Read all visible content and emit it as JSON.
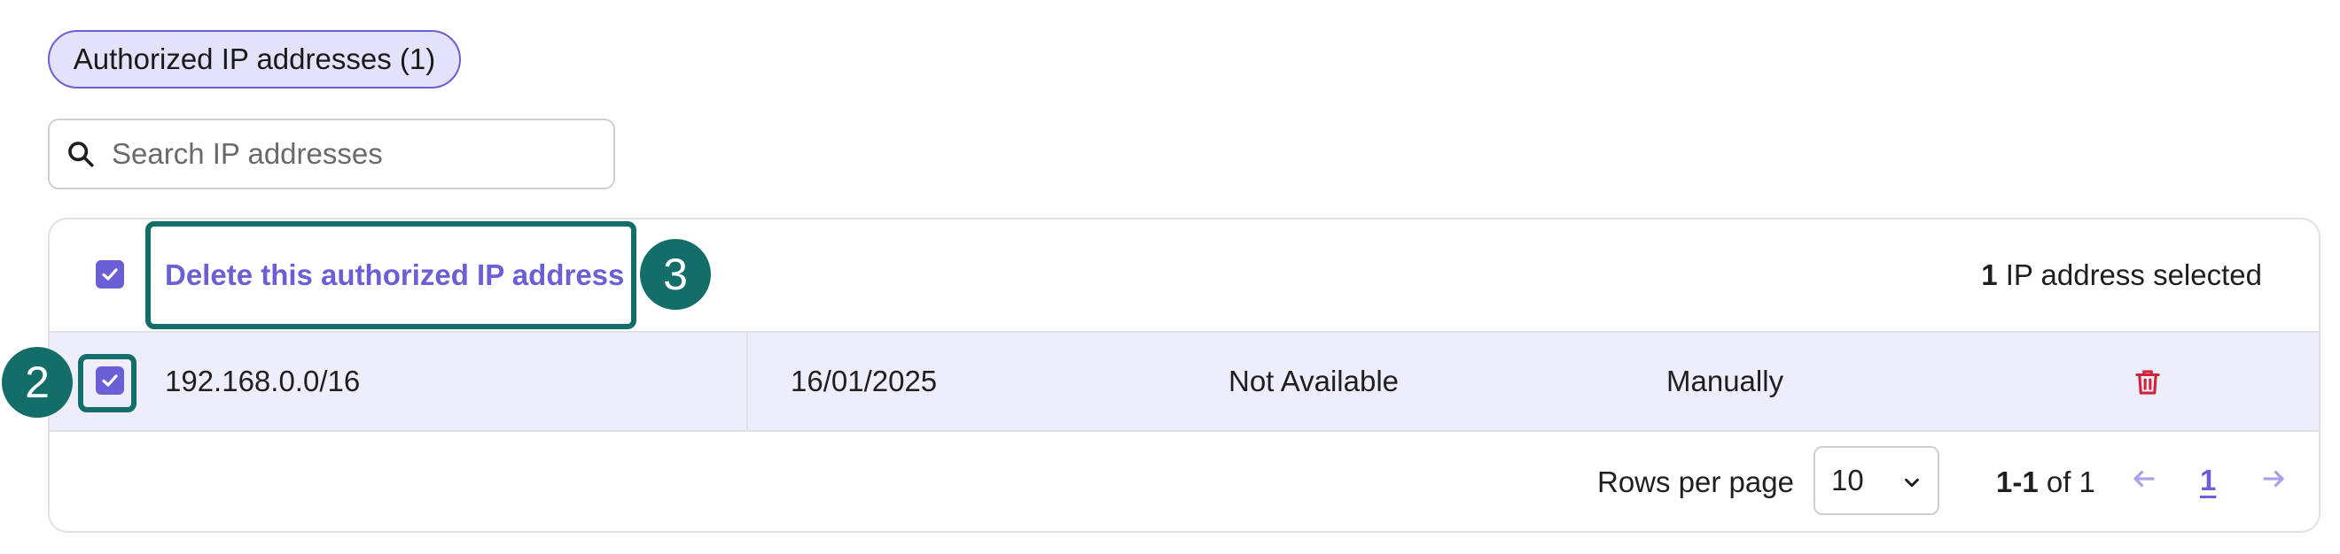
{
  "chip": {
    "label": "Authorized IP addresses (1)"
  },
  "search": {
    "placeholder": "Search IP addresses",
    "value": ""
  },
  "table": {
    "header": {
      "select_all_checked": true,
      "delete_action": "Delete this authorized IP address",
      "selected_count": "1",
      "selected_suffix": " IP address selected"
    },
    "rows": [
      {
        "checked": true,
        "ip": "192.168.0.0/16",
        "date": "16/01/2025",
        "status": "Not Available",
        "method": "Manually",
        "action_icon": "trash-icon"
      }
    ],
    "footer": {
      "rows_per_page_label": "Rows per page",
      "rows_per_page_value": "10",
      "range_bold": "1-1",
      "range_rest": " of 1",
      "current_page": "1"
    }
  },
  "annotations": {
    "marker_row_checkbox": "2",
    "marker_delete_link": "3"
  },
  "colors": {
    "accent": "#6b5fd6",
    "highlight": "#136e69",
    "danger": "#d1243a",
    "row_selected_bg": "#ededfb",
    "chip_bg": "#e4e1fa"
  }
}
